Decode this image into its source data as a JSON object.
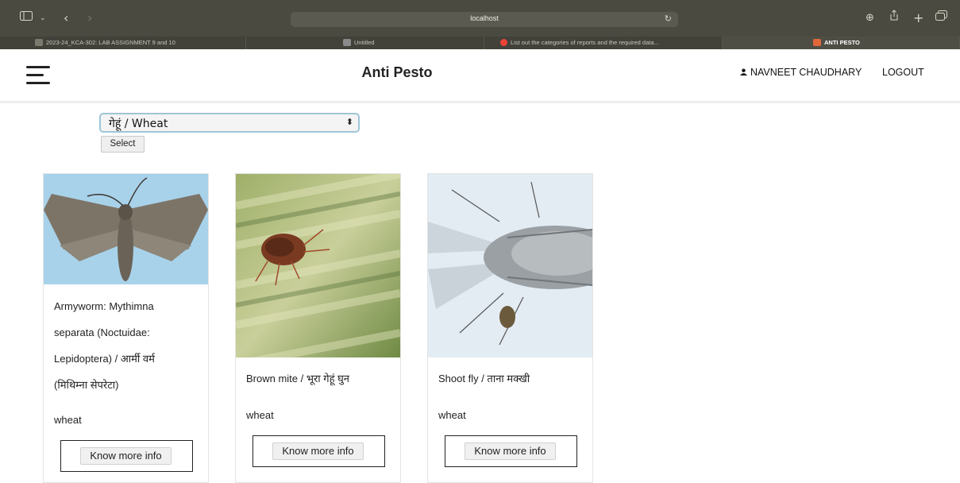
{
  "browser": {
    "url": "localhost",
    "tabs": [
      {
        "label": "2023-24_KCA-302: LAB ASSIGNMENT 9 and 10",
        "favicon_color": "#7a7a6e"
      },
      {
        "label": "Untitled",
        "favicon_color": "#8a8a8a"
      },
      {
        "label": "List out the categories of reports and the required data...",
        "favicon_color": "#ea4335"
      },
      {
        "label": "ANTI PESTO",
        "favicon_color": "#e0673a"
      }
    ]
  },
  "navbar": {
    "brand": "Anti Pesto",
    "user_name": "NAVNEET CHAUDHARY",
    "logout_label": "LOGOUT"
  },
  "filter": {
    "selected_crop": "गेहूं / Wheat",
    "select_button_label": "Select"
  },
  "cards": [
    {
      "title_lines": [
        "Armyworm: Mythimna",
        "separata (Noctuidae:",
        "Lepidoptera) / आर्मी वर्म",
        "(मिथिम्ना सेपरेटा)"
      ],
      "crop": "wheat",
      "button_label": "Know more info",
      "image_icon": "moth-image"
    },
    {
      "title_lines": [
        "Brown mite / भूरा गेहूं घुन"
      ],
      "crop": "wheat",
      "button_label": "Know more info",
      "image_icon": "mite-image"
    },
    {
      "title_lines": [
        "Shoot fly / ताना मक्खी"
      ],
      "crop": "wheat",
      "button_label": "Know more info",
      "image_icon": "fly-image"
    }
  ]
}
